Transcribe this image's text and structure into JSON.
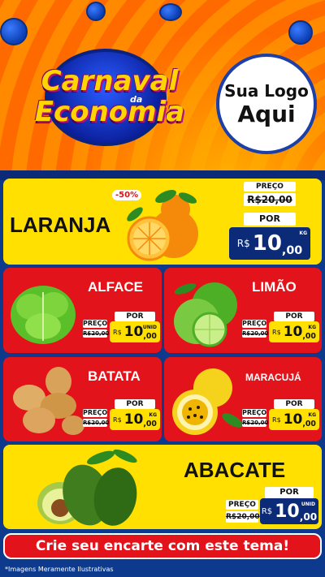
{
  "header": {
    "campaign_line1": "Carnaval",
    "campaign_da": "da",
    "campaign_line2": "Economia",
    "brand_line1": "Sua Logo",
    "brand_line2": "Aqui"
  },
  "labels": {
    "preco": "PREÇO",
    "por": "POR"
  },
  "products": {
    "laranja": {
      "name": "LARANJA",
      "badge": "-50%",
      "old": "R$20,00",
      "rs": "R$",
      "int": "10",
      "dec": ",00",
      "unit": "KG"
    },
    "alface": {
      "name": "ALFACE",
      "old": "R$20,00",
      "rs": "R$",
      "int": "10",
      "dec": ",00",
      "unit": "UNID"
    },
    "limao": {
      "name": "LIMÃO",
      "old": "R$20,00",
      "rs": "R$",
      "int": "10",
      "dec": ",00",
      "unit": "KG"
    },
    "batata": {
      "name": "BATATA",
      "old": "R$20,00",
      "rs": "R$",
      "int": "10",
      "dec": ",00",
      "unit": "KG"
    },
    "maracuja": {
      "name": "MARACUJÁ",
      "old": "R$20,00",
      "rs": "R$",
      "int": "10",
      "dec": ",00",
      "unit": "KG"
    },
    "abacate": {
      "name": "ABACATE",
      "old": "R$20,00",
      "rs": "R$",
      "int": "10",
      "dec": ",00",
      "unit": "UNID"
    }
  },
  "cta": "Crie seu encarte com este tema!",
  "footnote": "*Imagens Meramente Ilustrativas",
  "colors": {
    "navy": "#0b2a78",
    "red": "#e3131b",
    "yellow": "#ffe000",
    "orange": "#ff7a00"
  }
}
